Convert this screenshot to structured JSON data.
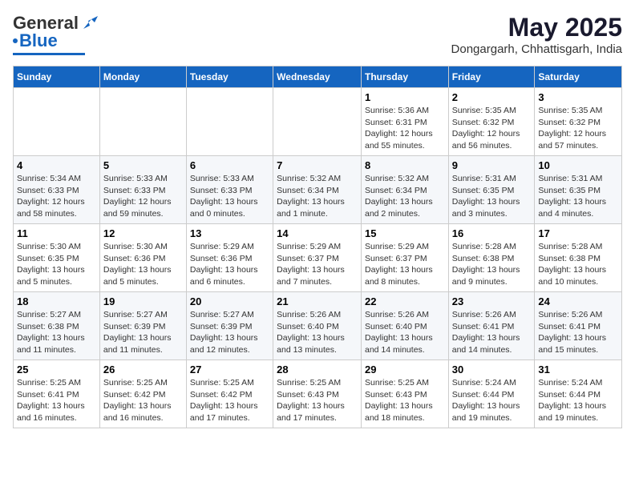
{
  "header": {
    "logo_general": "General",
    "logo_blue": "Blue",
    "month_title": "May 2025",
    "location": "Dongargarh, Chhattisgarh, India"
  },
  "days_of_week": [
    "Sunday",
    "Monday",
    "Tuesday",
    "Wednesday",
    "Thursday",
    "Friday",
    "Saturday"
  ],
  "weeks": [
    [
      {
        "day": "",
        "info": ""
      },
      {
        "day": "",
        "info": ""
      },
      {
        "day": "",
        "info": ""
      },
      {
        "day": "",
        "info": ""
      },
      {
        "day": "1",
        "info": "Sunrise: 5:36 AM\nSunset: 6:31 PM\nDaylight: 12 hours\nand 55 minutes."
      },
      {
        "day": "2",
        "info": "Sunrise: 5:35 AM\nSunset: 6:32 PM\nDaylight: 12 hours\nand 56 minutes."
      },
      {
        "day": "3",
        "info": "Sunrise: 5:35 AM\nSunset: 6:32 PM\nDaylight: 12 hours\nand 57 minutes."
      }
    ],
    [
      {
        "day": "4",
        "info": "Sunrise: 5:34 AM\nSunset: 6:33 PM\nDaylight: 12 hours\nand 58 minutes."
      },
      {
        "day": "5",
        "info": "Sunrise: 5:33 AM\nSunset: 6:33 PM\nDaylight: 12 hours\nand 59 minutes."
      },
      {
        "day": "6",
        "info": "Sunrise: 5:33 AM\nSunset: 6:33 PM\nDaylight: 13 hours\nand 0 minutes."
      },
      {
        "day": "7",
        "info": "Sunrise: 5:32 AM\nSunset: 6:34 PM\nDaylight: 13 hours\nand 1 minute."
      },
      {
        "day": "8",
        "info": "Sunrise: 5:32 AM\nSunset: 6:34 PM\nDaylight: 13 hours\nand 2 minutes."
      },
      {
        "day": "9",
        "info": "Sunrise: 5:31 AM\nSunset: 6:35 PM\nDaylight: 13 hours\nand 3 minutes."
      },
      {
        "day": "10",
        "info": "Sunrise: 5:31 AM\nSunset: 6:35 PM\nDaylight: 13 hours\nand 4 minutes."
      }
    ],
    [
      {
        "day": "11",
        "info": "Sunrise: 5:30 AM\nSunset: 6:35 PM\nDaylight: 13 hours\nand 5 minutes."
      },
      {
        "day": "12",
        "info": "Sunrise: 5:30 AM\nSunset: 6:36 PM\nDaylight: 13 hours\nand 5 minutes."
      },
      {
        "day": "13",
        "info": "Sunrise: 5:29 AM\nSunset: 6:36 PM\nDaylight: 13 hours\nand 6 minutes."
      },
      {
        "day": "14",
        "info": "Sunrise: 5:29 AM\nSunset: 6:37 PM\nDaylight: 13 hours\nand 7 minutes."
      },
      {
        "day": "15",
        "info": "Sunrise: 5:29 AM\nSunset: 6:37 PM\nDaylight: 13 hours\nand 8 minutes."
      },
      {
        "day": "16",
        "info": "Sunrise: 5:28 AM\nSunset: 6:38 PM\nDaylight: 13 hours\nand 9 minutes."
      },
      {
        "day": "17",
        "info": "Sunrise: 5:28 AM\nSunset: 6:38 PM\nDaylight: 13 hours\nand 10 minutes."
      }
    ],
    [
      {
        "day": "18",
        "info": "Sunrise: 5:27 AM\nSunset: 6:38 PM\nDaylight: 13 hours\nand 11 minutes."
      },
      {
        "day": "19",
        "info": "Sunrise: 5:27 AM\nSunset: 6:39 PM\nDaylight: 13 hours\nand 11 minutes."
      },
      {
        "day": "20",
        "info": "Sunrise: 5:27 AM\nSunset: 6:39 PM\nDaylight: 13 hours\nand 12 minutes."
      },
      {
        "day": "21",
        "info": "Sunrise: 5:26 AM\nSunset: 6:40 PM\nDaylight: 13 hours\nand 13 minutes."
      },
      {
        "day": "22",
        "info": "Sunrise: 5:26 AM\nSunset: 6:40 PM\nDaylight: 13 hours\nand 14 minutes."
      },
      {
        "day": "23",
        "info": "Sunrise: 5:26 AM\nSunset: 6:41 PM\nDaylight: 13 hours\nand 14 minutes."
      },
      {
        "day": "24",
        "info": "Sunrise: 5:26 AM\nSunset: 6:41 PM\nDaylight: 13 hours\nand 15 minutes."
      }
    ],
    [
      {
        "day": "25",
        "info": "Sunrise: 5:25 AM\nSunset: 6:41 PM\nDaylight: 13 hours\nand 16 minutes."
      },
      {
        "day": "26",
        "info": "Sunrise: 5:25 AM\nSunset: 6:42 PM\nDaylight: 13 hours\nand 16 minutes."
      },
      {
        "day": "27",
        "info": "Sunrise: 5:25 AM\nSunset: 6:42 PM\nDaylight: 13 hours\nand 17 minutes."
      },
      {
        "day": "28",
        "info": "Sunrise: 5:25 AM\nSunset: 6:43 PM\nDaylight: 13 hours\nand 17 minutes."
      },
      {
        "day": "29",
        "info": "Sunrise: 5:25 AM\nSunset: 6:43 PM\nDaylight: 13 hours\nand 18 minutes."
      },
      {
        "day": "30",
        "info": "Sunrise: 5:24 AM\nSunset: 6:44 PM\nDaylight: 13 hours\nand 19 minutes."
      },
      {
        "day": "31",
        "info": "Sunrise: 5:24 AM\nSunset: 6:44 PM\nDaylight: 13 hours\nand 19 minutes."
      }
    ]
  ]
}
